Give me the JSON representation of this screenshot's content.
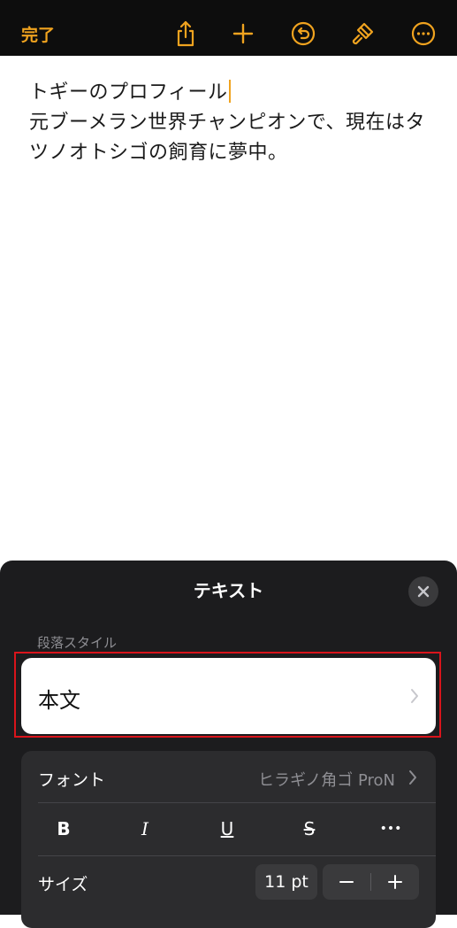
{
  "toolbar": {
    "done_label": "完了",
    "accent_color": "#f0a31f",
    "icons": [
      "share-icon",
      "plus-icon",
      "undo-icon",
      "paintbrush-icon",
      "more-icon"
    ]
  },
  "document": {
    "title_line": "トギーのプロフィール",
    "body_line": "元ブーメラン世界チャンピオンで、現在はタツノオトシゴの飼育に夢中。"
  },
  "sheet": {
    "title": "テキスト",
    "paragraph_style_label": "段落スタイル",
    "paragraph_style_value": "本文",
    "font_label": "フォント",
    "font_value": "ヒラギノ角ゴ ProN",
    "format_buttons": [
      "B",
      "I",
      "U",
      "S",
      "•••"
    ],
    "size_label": "サイズ",
    "size_value": "11 pt"
  }
}
